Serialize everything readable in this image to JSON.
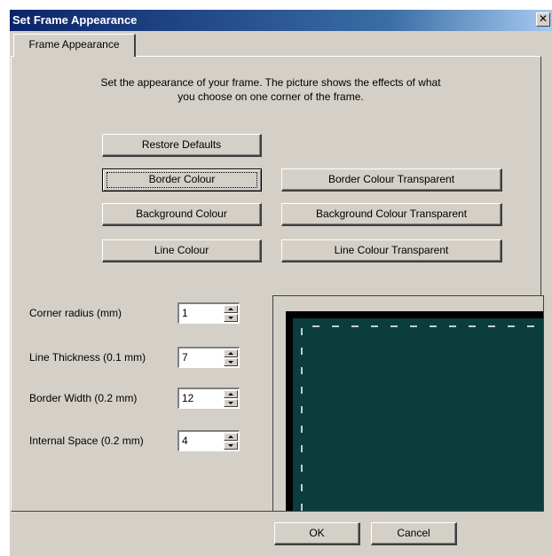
{
  "window": {
    "title": "Set Frame Appearance",
    "close_label": "✕"
  },
  "tab": {
    "label": "Frame Appearance"
  },
  "description": {
    "line1": "Set the appearance of your frame. The picture shows the effects of what",
    "line2": "you choose on one corner of the frame."
  },
  "buttons": {
    "restore_defaults": "Restore Defaults",
    "border_colour": "Border Colour",
    "border_colour_transparent": "Border Colour Transparent",
    "background_colour": "Background Colour",
    "background_colour_transparent": "Background Colour Transparent",
    "line_colour": "Line Colour",
    "line_colour_transparent": "Line Colour Transparent",
    "ok": "OK",
    "cancel": "Cancel"
  },
  "fields": [
    {
      "label": "Corner radius (mm)",
      "value": "1"
    },
    {
      "label": "Line Thickness (0.1 mm)",
      "value": "7"
    },
    {
      "label": "Border Width (0.2 mm)",
      "value": "12"
    },
    {
      "label": "Internal Space (0.2 mm)",
      "value": "4"
    }
  ],
  "preview": {
    "border_color": "#000000",
    "background_color": "#0b3d3d",
    "line_color": "#ffffff"
  },
  "colors": {
    "title_start": "#0a246a",
    "face": "#d4d0c8"
  }
}
